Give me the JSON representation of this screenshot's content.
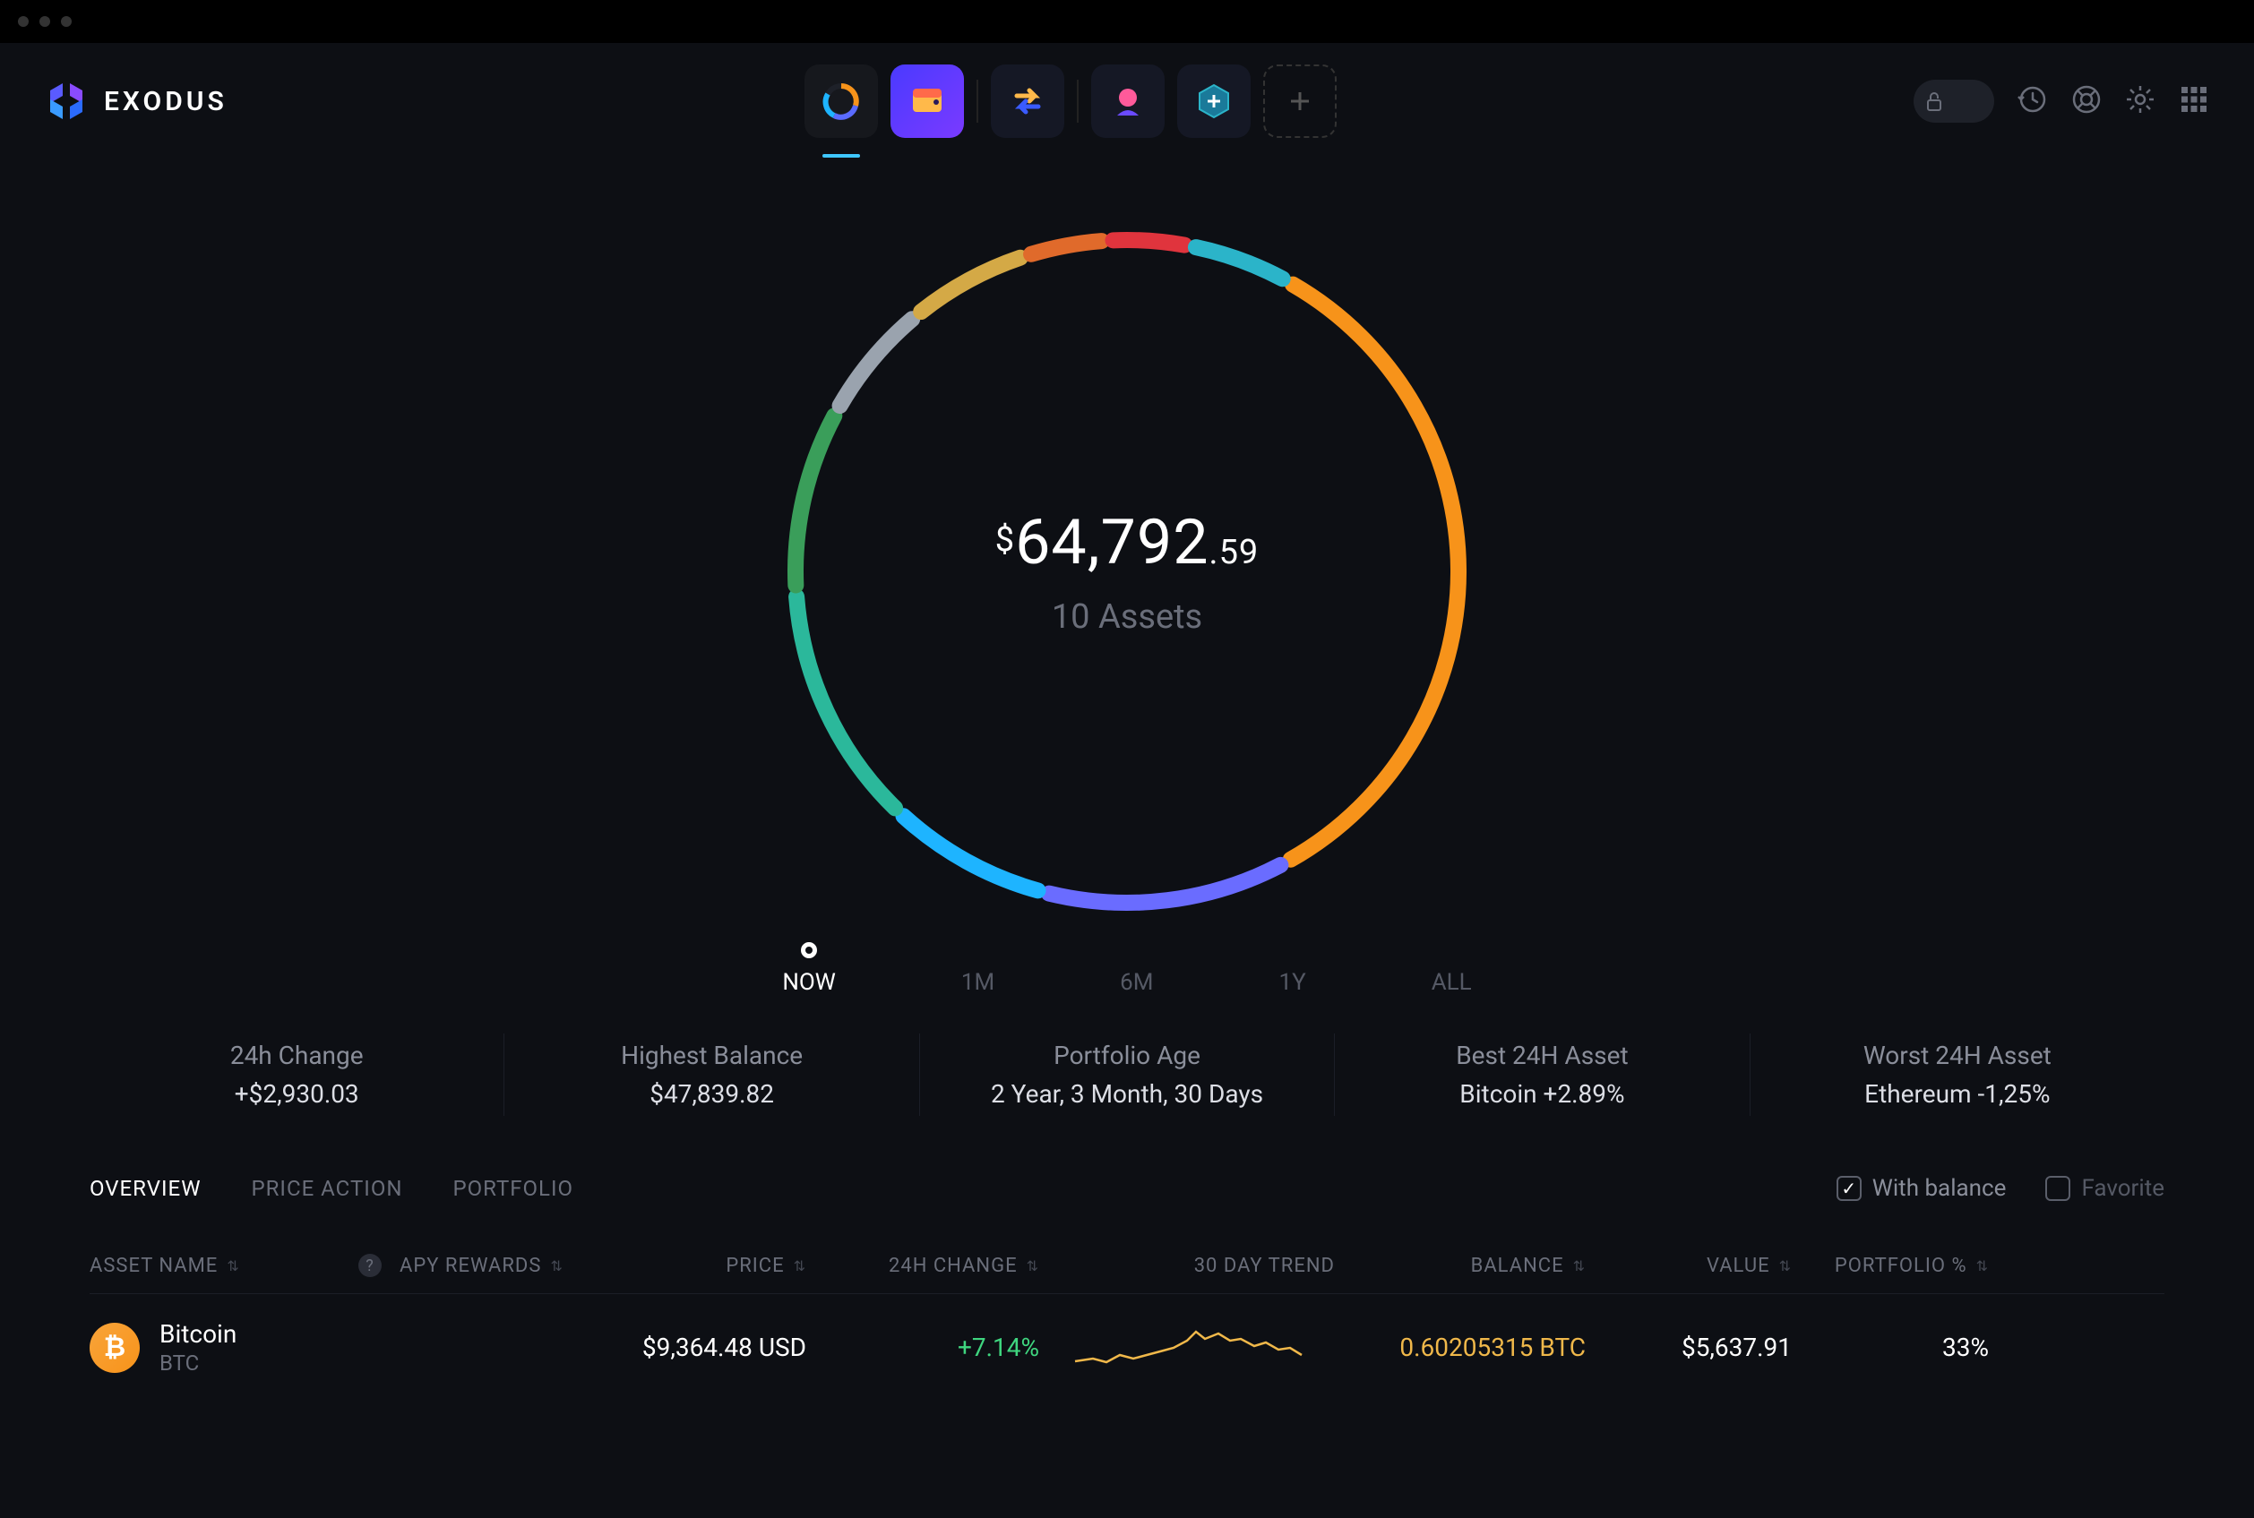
{
  "app_name": "EXODUS",
  "portfolio": {
    "currency": "$",
    "balance_whole": "64,792",
    "balance_cents": ".59",
    "assets_count": "10 Assets"
  },
  "chart_data": {
    "type": "pie",
    "title": "Portfolio allocation",
    "slices": [
      {
        "name": "Orange segment",
        "percent": 34,
        "color": "#f7931a"
      },
      {
        "name": "Purple-blue segment",
        "percent": 12,
        "color": "#6a6cff"
      },
      {
        "name": "Blue segment",
        "percent": 8,
        "color": "#1eb4ff"
      },
      {
        "name": "Teal segment",
        "percent": 12,
        "color": "#2bb89b"
      },
      {
        "name": "Green segment",
        "percent": 9,
        "color": "#3a9e5a"
      },
      {
        "name": "Gray segment",
        "percent": 6,
        "color": "#9aa3ae"
      },
      {
        "name": "Gold segment",
        "percent": 6,
        "color": "#d4a946"
      },
      {
        "name": "Dark-orange segment",
        "percent": 4,
        "color": "#e06a2b"
      },
      {
        "name": "Red segment",
        "percent": 4,
        "color": "#e0343d"
      },
      {
        "name": "Cyan segment",
        "percent": 5,
        "color": "#2bb4c9"
      }
    ]
  },
  "ranges": [
    {
      "label": "NOW",
      "active": true
    },
    {
      "label": "1M",
      "active": false
    },
    {
      "label": "6M",
      "active": false
    },
    {
      "label": "1Y",
      "active": false
    },
    {
      "label": "ALL",
      "active": false
    }
  ],
  "stats": {
    "change24h": {
      "label": "24h Change",
      "value": "+$2,930.03"
    },
    "highest": {
      "label": "Highest Balance",
      "value": "$47,839.82"
    },
    "age": {
      "label": "Portfolio Age",
      "value": "2 Year, 3 Month, 30 Days"
    },
    "best": {
      "label": "Best 24H Asset",
      "value": "Bitcoin +2.89%"
    },
    "worst": {
      "label": "Worst 24H Asset",
      "value": "Ethereum -1,25%"
    }
  },
  "tabs": [
    {
      "label": "OVERVIEW",
      "active": true
    },
    {
      "label": "PRICE ACTION",
      "active": false
    },
    {
      "label": "PORTFOLIO",
      "active": false
    }
  ],
  "filters": {
    "with_balance": "With balance",
    "favorite": "Favorite"
  },
  "columns": {
    "asset": "ASSET NAME",
    "apy": "APY REWARDS",
    "price": "PRICE",
    "change": "24H CHANGE",
    "trend": "30 DAY TREND",
    "balance": "BALANCE",
    "value": "VALUE",
    "pct": "PORTFOLIO %"
  },
  "rows": [
    {
      "name": "Bitcoin",
      "ticker": "BTC",
      "price": "$9,364.48 USD",
      "change": "+7.14%",
      "balance": "0.60205315 BTC",
      "value": "$5,637.91",
      "pct": "33%"
    }
  ]
}
